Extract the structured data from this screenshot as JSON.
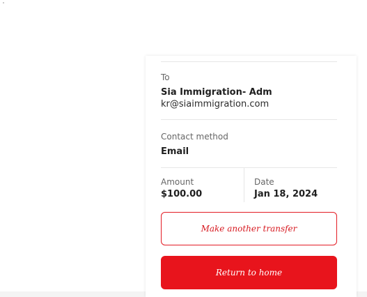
{
  "recipient": {
    "label": "To",
    "name": "Sia Immigration- Adm",
    "email": "kr@siaimmigration.com"
  },
  "contact": {
    "label": "Contact method",
    "value": "Email"
  },
  "amount": {
    "label": "Amount",
    "value": "$100.00"
  },
  "date": {
    "label": "Date",
    "value": "Jan 18, 2024"
  },
  "buttons": {
    "another_transfer": "Make another transfer",
    "return_home": "Return to home"
  },
  "colors": {
    "accent": "#e8141c",
    "page_background": "#ffffff"
  }
}
